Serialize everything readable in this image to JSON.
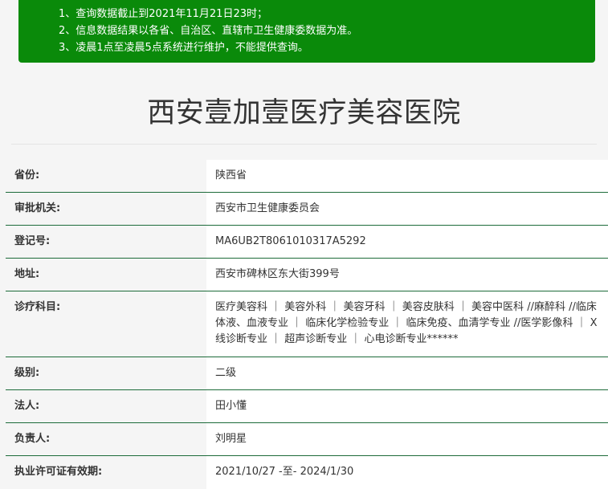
{
  "notice": {
    "lines": [
      "1、查询数据截止到2021年11月21日23时；",
      "2、信息数据结果以各省、自治区、直辖市卫生健康委数据为准。",
      "3、凌晨1点至凌晨5点系统进行维护，不能提供查询。"
    ]
  },
  "page_title": "西安壹加壹医疗美容医院",
  "fields": [
    {
      "label": "省份:",
      "value": "陕西省"
    },
    {
      "label": "审批机关:",
      "value": "西安市卫生健康委员会"
    },
    {
      "label": "登记号:",
      "value": "MA6UB2T8061010317A5292"
    },
    {
      "label": "地址:",
      "value": "西安市碑林区东大街399号"
    },
    {
      "label": "诊疗科目:",
      "value": "医疗美容科 ｜ 美容外科 ｜ 美容牙科 ｜ 美容皮肤科 ｜ 美容中医科 //麻醉科 //临床体液、血液专业 ｜ 临床化学检验专业 ｜ 临床免疫、血清学专业 //医学影像科 ｜ X线诊断专业 ｜ 超声诊断专业 ｜ 心电诊断专业******"
    },
    {
      "label": "级别:",
      "value": "二级"
    },
    {
      "label": "法人:",
      "value": "田小懂"
    },
    {
      "label": "负责人:",
      "value": "刘明星"
    },
    {
      "label": "执业许可证有效期:",
      "value": "2021/10/27 -至- 2024/1/30"
    }
  ],
  "colors": {
    "notice_bg": "#0a8a0a",
    "row_border": "#1d6b3a",
    "page_bg": "#f5f5f5"
  }
}
